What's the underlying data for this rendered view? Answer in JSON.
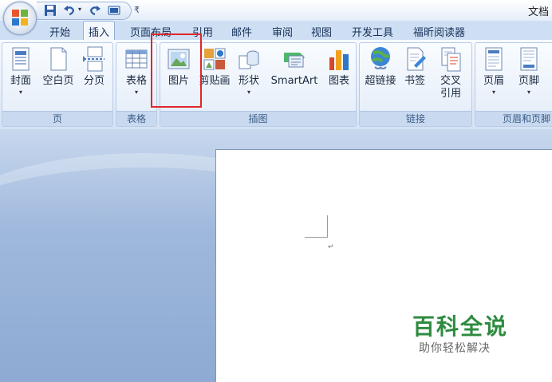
{
  "title_bar": {
    "document_title": "文档",
    "qat_more": "₹"
  },
  "tabs": [
    "开始",
    "插入",
    "页面布局",
    "引用",
    "邮件",
    "审阅",
    "视图",
    "开发工具",
    "福昕阅读器"
  ],
  "ribbon": {
    "groups": {
      "pages": {
        "label": "页",
        "buttons": [
          "封面",
          "空白页",
          "分页"
        ]
      },
      "tables": {
        "label": "表格",
        "buttons": [
          "表格"
        ]
      },
      "illustrations": {
        "label": "插图",
        "buttons": [
          "图片",
          "剪贴画",
          "形状",
          "SmartArt",
          "图表"
        ]
      },
      "links": {
        "label": "链接",
        "buttons": [
          "超链接",
          "书签",
          "交叉",
          "引用"
        ]
      },
      "header_footer": {
        "label": "页眉和页脚",
        "buttons": [
          "页眉",
          "页脚"
        ]
      }
    },
    "dropdown_arrow": "▾"
  },
  "document": {
    "paragraph_mark": "↵"
  },
  "watermark": {
    "title": "百科全说",
    "subtitle": "助你轻松解决"
  },
  "colors": {
    "highlight": "#e0262a",
    "watermark_green": "#2e8b3f",
    "ribbon_bg": "#e6eef9"
  }
}
